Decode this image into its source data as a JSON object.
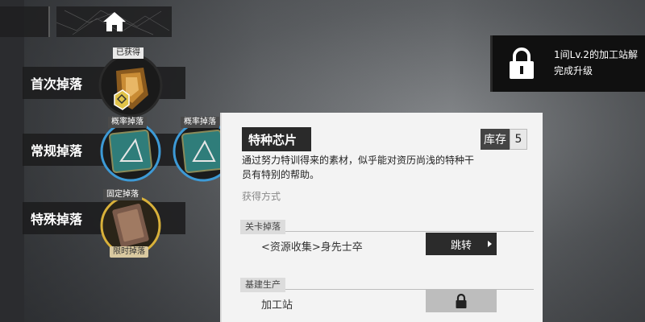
{
  "nav": {
    "home_icon": "home-icon"
  },
  "drops": [
    {
      "label": "首次掉落",
      "tag": "已获得"
    },
    {
      "label": "常规掉落",
      "tag": "概率掉落",
      "tag2": "概率掉落"
    },
    {
      "label": "特殊掉落",
      "tag": "固定掉落",
      "badge": "限时掉落"
    }
  ],
  "lock_notice": {
    "line1": "1间Lv.2的加工站解",
    "line2": "完成升级"
  },
  "panel": {
    "title": "特种芯片",
    "stock_label": "库存",
    "stock_value": "5",
    "description_line1": "通过努力特训得来的素材，似乎能对资历尚浅的特种干",
    "description_line2": "员有特别的帮助。",
    "obtain_label": "获得方式",
    "section1": "关卡掉落",
    "stage_name": "<资源收集>身先士卒",
    "jump_label": "跳转",
    "section2": "基建生产",
    "facility_name": "加工站"
  },
  "colors": {
    "ring_blue": "#3d9ad6",
    "ring_gold": "#d9b13a",
    "chip_teal": "#2f7d7a"
  }
}
